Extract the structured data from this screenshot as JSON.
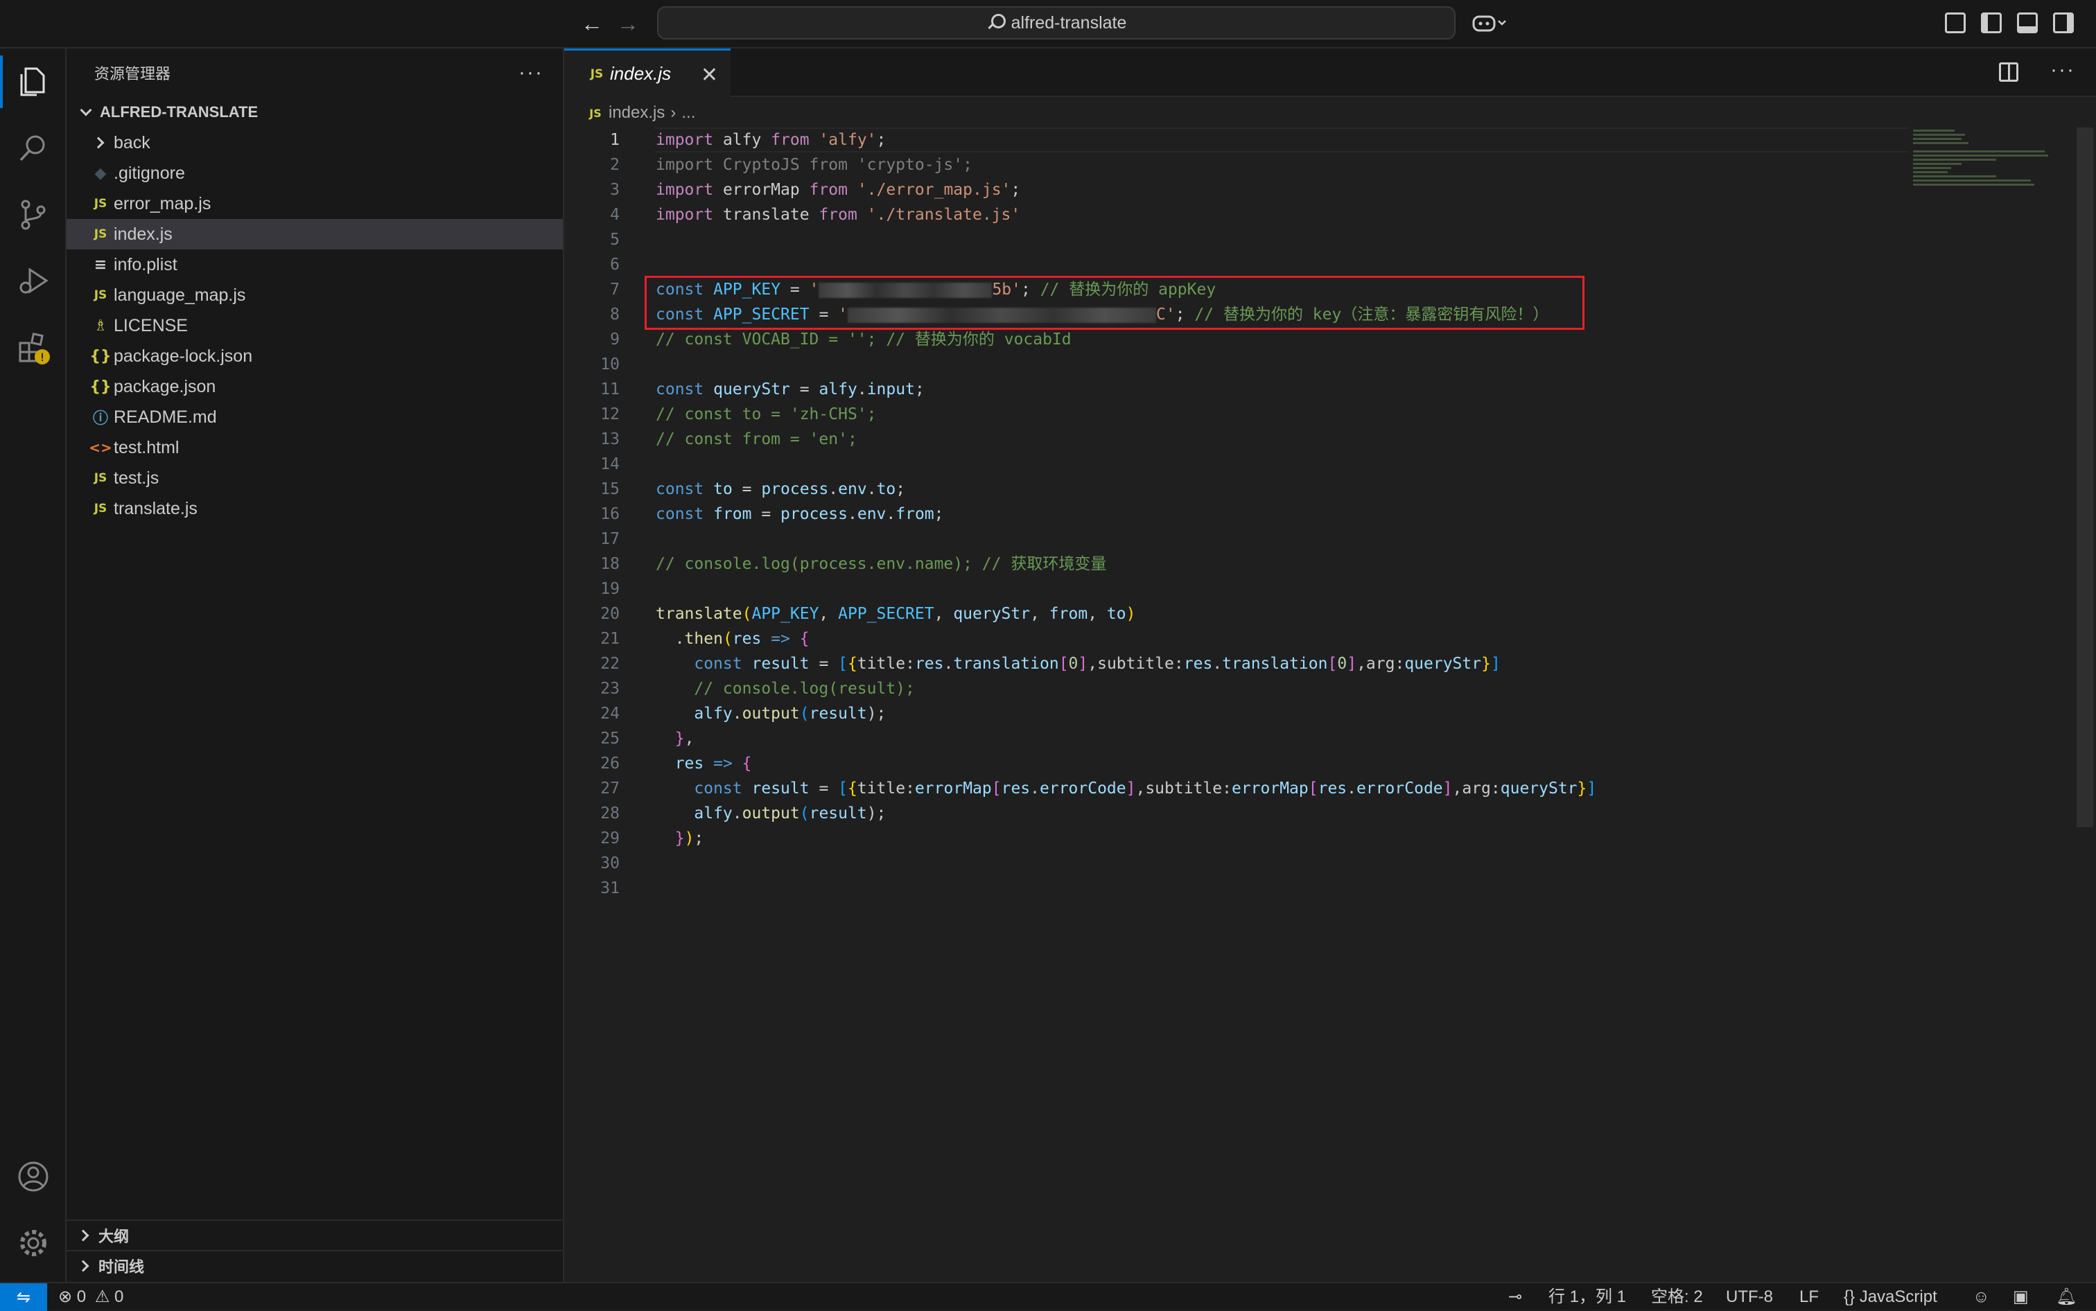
{
  "titlebar": {
    "search_text": "alfred-translate",
    "back": "←",
    "forward": "→"
  },
  "sidebar": {
    "title": "资源管理器",
    "more": "···",
    "folder": "ALFRED-TRANSLATE",
    "files": [
      {
        "name": "back",
        "icon": "folder"
      },
      {
        "name": ".gitignore",
        "icon": "git-icon"
      },
      {
        "name": "error_map.js",
        "icon": "js-icon"
      },
      {
        "name": "index.js",
        "icon": "js-icon"
      },
      {
        "name": "info.plist",
        "icon": "plist-icon"
      },
      {
        "name": "language_map.js",
        "icon": "js-icon"
      },
      {
        "name": "LICENSE",
        "icon": "license-icon"
      },
      {
        "name": "package-lock.json",
        "icon": "json-icon"
      },
      {
        "name": "package.json",
        "icon": "json-icon"
      },
      {
        "name": "README.md",
        "icon": "info-icon"
      },
      {
        "name": "test.html",
        "icon": "html-icon"
      },
      {
        "name": "test.js",
        "icon": "js-icon"
      },
      {
        "name": "translate.js",
        "icon": "js-icon"
      }
    ],
    "outline": "大纲",
    "timeline": "时间线"
  },
  "editor": {
    "tab_label": "index.js",
    "tab_icon": "JS",
    "close": "✕",
    "breadcrumb_file": "index.js",
    "breadcrumb_rest": "...",
    "lines": {
      "l1": [
        "import",
        " alfy ",
        "from",
        " ",
        "'alfy'",
        ";"
      ],
      "l2": "import CryptoJS from 'crypto-js';",
      "l3": [
        "import",
        " errorMap ",
        "from",
        " ",
        "'./error_map.js'",
        ";"
      ],
      "l4": [
        "import",
        " translate ",
        "from",
        " ",
        "'./translate.js'"
      ],
      "l7": [
        "const",
        " ",
        "APP_KEY",
        " = ",
        "'",
        "5b'",
        "; ",
        "// 替换为你的 appKey"
      ],
      "l8": [
        "const",
        " ",
        "APP_SECRET",
        " = ",
        "'",
        "C'",
        "; ",
        "// 替换为你的 key（注意：暴露密钥有风险！）"
      ],
      "l9": "// const VOCAB_ID = ''; // 替换为你的 vocabId",
      "l11": [
        "const",
        " ",
        "queryStr",
        " = ",
        "alfy",
        ".",
        "input",
        ";"
      ],
      "l12": "// const to = 'zh-CHS';",
      "l13": "// const from = 'en';",
      "l15": [
        "const",
        " ",
        "to",
        " = ",
        "process",
        ".",
        "env",
        ".",
        "to",
        ";"
      ],
      "l16": [
        "const",
        " ",
        "from",
        " = ",
        "process",
        ".",
        "env",
        ".",
        "from",
        ";"
      ],
      "l18": "// console.log(process.env.name); // 获取环境变量",
      "l20": [
        "translate",
        "(",
        "APP_KEY",
        ", ",
        "APP_SECRET",
        ", ",
        "queryStr",
        ", ",
        "from",
        ", ",
        "to",
        ")"
      ],
      "l21": [
        "  .",
        "then",
        "(",
        "res",
        " ",
        "=>",
        " ",
        "{"
      ],
      "l22": [
        "    ",
        "const",
        " ",
        "result",
        " = ",
        "[",
        "{",
        "title:",
        "res",
        ".",
        "translation",
        "[",
        "0",
        "]",
        ",subtitle:",
        "res",
        ".",
        "translation",
        "[",
        "0",
        "]",
        ",arg:",
        "queryStr",
        "}",
        "]"
      ],
      "l23": "    // console.log(result);",
      "l24": [
        "    ",
        "alfy",
        ".",
        "output",
        "(",
        "result",
        ");"
      ],
      "l25": [
        "  ",
        "}",
        ","
      ],
      "l26": [
        "  ",
        "res",
        " ",
        "=>",
        " ",
        "{"
      ],
      "l27": [
        "    ",
        "const",
        " ",
        "result",
        " = ",
        "[",
        "{",
        "title:",
        "errorMap",
        "[",
        "res",
        ".",
        "errorCode",
        "]",
        ",subtitle:",
        "errorMap",
        "[",
        "res",
        ".",
        "errorCode",
        "]",
        ",arg:",
        "queryStr",
        "}",
        "]"
      ],
      "l28": [
        "    ",
        "alfy",
        ".",
        "output",
        "(",
        "result",
        ");"
      ],
      "l29": [
        "  ",
        "}",
        ")",
        ";"
      ]
    },
    "line_numbers": [
      "1",
      "2",
      "3",
      "4",
      "5",
      "6",
      "7",
      "8",
      "9",
      "10",
      "11",
      "12",
      "13",
      "14",
      "15",
      "16",
      "17",
      "18",
      "19",
      "20",
      "21",
      "22",
      "23",
      "24",
      "25",
      "26",
      "27",
      "28",
      "29",
      "30",
      "31"
    ]
  },
  "status": {
    "errors": "0",
    "warnings": "0",
    "position": "行 1，列 1",
    "spaces": "空格: 2",
    "encoding": "UTF-8",
    "eol": "LF",
    "language": "JavaScript"
  },
  "colors": {
    "accent": "#0078d4",
    "highlight_box": "#e5202a",
    "warning_badge": "#cca700"
  }
}
